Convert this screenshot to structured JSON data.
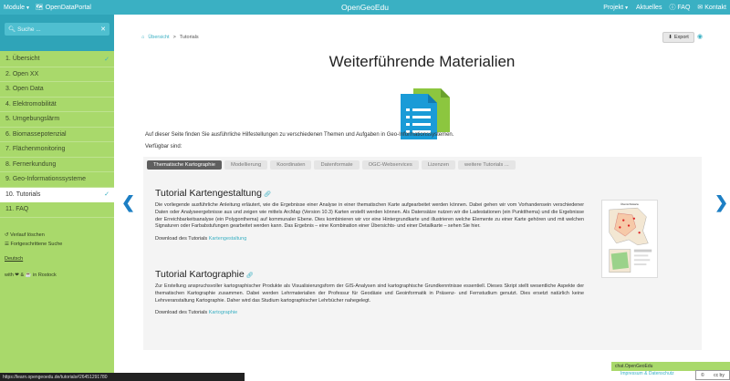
{
  "topbar": {
    "module_label": "Module",
    "portal_label": "OpenDataPortal",
    "brand": "OpenGeoEdu",
    "projekt_label": "Projekt",
    "aktuelles_label": "Aktuelles",
    "faq_label": "FAQ",
    "kontakt_label": "Kontakt"
  },
  "search": {
    "placeholder": "Suche ..."
  },
  "sidebar": {
    "items": [
      {
        "num": "1.",
        "label": "Übersicht",
        "checked": true
      },
      {
        "num": "2.",
        "label": "Open XX"
      },
      {
        "num": "3.",
        "label": "Open Data"
      },
      {
        "num": "4.",
        "label": "Elektromobilität"
      },
      {
        "num": "5.",
        "label": "Umgebungslärm"
      },
      {
        "num": "6.",
        "label": "Biomassepotenzial"
      },
      {
        "num": "7.",
        "label": "Flächenmonitoring"
      },
      {
        "num": "8.",
        "label": "Fernerkundung"
      },
      {
        "num": "9.",
        "label": "Geo-Informationssysteme"
      },
      {
        "num": "10.",
        "label": "Tutorials",
        "active": true,
        "checked": true
      },
      {
        "num": "11.",
        "label": "FAQ"
      }
    ],
    "verlauf": "Verlauf löschen",
    "fortgeschrittene": "Fortgeschrittene Suche",
    "language": "Deutsch",
    "with_text": "with ❤ & ☕ in Rostock"
  },
  "breadcrumb": {
    "home_link": "Übersicht",
    "separator": ">",
    "current": "Tutorials"
  },
  "export_label": "Export",
  "page_title": "Weiterführende Materialien",
  "intro": "Auf dieser Seite finden Sie ausführliche Hilfestellungen zu verschiedenen Themen und Aufgaben in Geo-Informationssystemen.",
  "available": "Verfügbar sind:",
  "tabs": [
    {
      "label": "Thematische Kartographie",
      "active": true
    },
    {
      "label": "Modellierung"
    },
    {
      "label": "Koordinaten"
    },
    {
      "label": "Datenformate"
    },
    {
      "label": "OGC-Webservices"
    },
    {
      "label": "Lizenzen"
    },
    {
      "label": "weitere Tutorials ..."
    }
  ],
  "sections": [
    {
      "title": "Tutorial Kartengestaltung",
      "text": "Die vorliegende ausführliche Anleitung erläutert, wie die Ergebnisse einer Analyse in einer thematischen Karte aufgearbeitet werden können. Dabei gehen wir vom Vorhandensein verschiedener Daten oder Analyseergebnisse aus und zeigen wie mittels ArcMap (Version 10.3) Karten erstellt werden können. Als Datensätze nutzen wir die Ladestationen (ein Punktthema) und die Ergebnisse der Erreichbarkeitsanalyse (ein Polygonthema) auf kommunaler Ebene. Dies kombinieren wir vor eine Hintergrundkarte und illustrieren welche Elemente zu einer Karte gehören und mit welchen Signaturen oder Farbabstufungen gearbeitet werden kann. Das Ergebnis – eine Kombination einer Übersichts- und einer Detailkarte – sehen Sie hier.",
      "download_prefix": "Download des Tutorials ",
      "download_link": "Kartengestaltung"
    },
    {
      "title": "Tutorial Kartographie",
      "text": "Zur Erstellung anspruchsvoller kartographischer Produkte als Visualisierungsform der GIS-Analysen sind kartographische Grundkenntnisse essentiell. Dieses Skript stellt wesentliche Aspekte der thematischen Kartographie zusammen. Dabei werden Lehrmaterialien der Professur für Geodäsie und Geoinformatik in Präsenz- und Fernstudium genutzt. Dies ersetzt natürlich keine Lehrveranstaltung Kartographie. Daher wird das Studium kartographischer Lehrbücher nahegelegt.",
      "download_prefix": "Download des Tutorials ",
      "download_link": "Kartographie"
    }
  ],
  "thumb_title": "Übersichtskarte",
  "status_url": "https://learn.opengeoedu.de/tutorials#26451291780",
  "footer": {
    "badge": "chat.OpenGeoEdu",
    "links": "Impressum & Datenschutz",
    "cc": "cc by"
  },
  "colors": {
    "topbar": "#3ab0c3",
    "sidebar": "#a9d96b",
    "accent": "#3ab0c3",
    "arrow": "#1d7fc4"
  }
}
